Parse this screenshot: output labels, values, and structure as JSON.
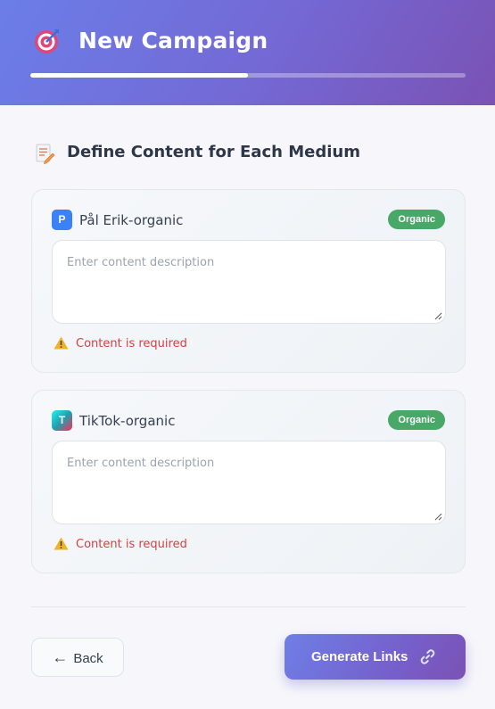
{
  "header": {
    "title": "New Campaign",
    "icon": "target-dart-icon",
    "progress_fraction": 0.5
  },
  "section": {
    "title": "Define Content for Each Medium",
    "icon": "memo-pencil-icon"
  },
  "mediums": [
    {
      "badge_letter": "P",
      "name": "Pål Erik-organic",
      "type_label": "Organic",
      "content_value": "",
      "content_placeholder": "Enter content description",
      "error": "Content is required"
    },
    {
      "badge_letter": "T",
      "name": "TikTok-organic",
      "type_label": "Organic",
      "content_value": "",
      "content_placeholder": "Enter content description",
      "error": "Content is required"
    }
  ],
  "footer": {
    "back_arrow": "←",
    "back_label": "Back",
    "generate_label": "Generate Links",
    "generate_icon": "link-icon"
  },
  "colors": {
    "header_start": "#6b7ee8",
    "header_end": "#7a52b4",
    "organic_pill": "#48a868",
    "error": "#d63f3f",
    "primary_badge": "#3b82f6"
  }
}
